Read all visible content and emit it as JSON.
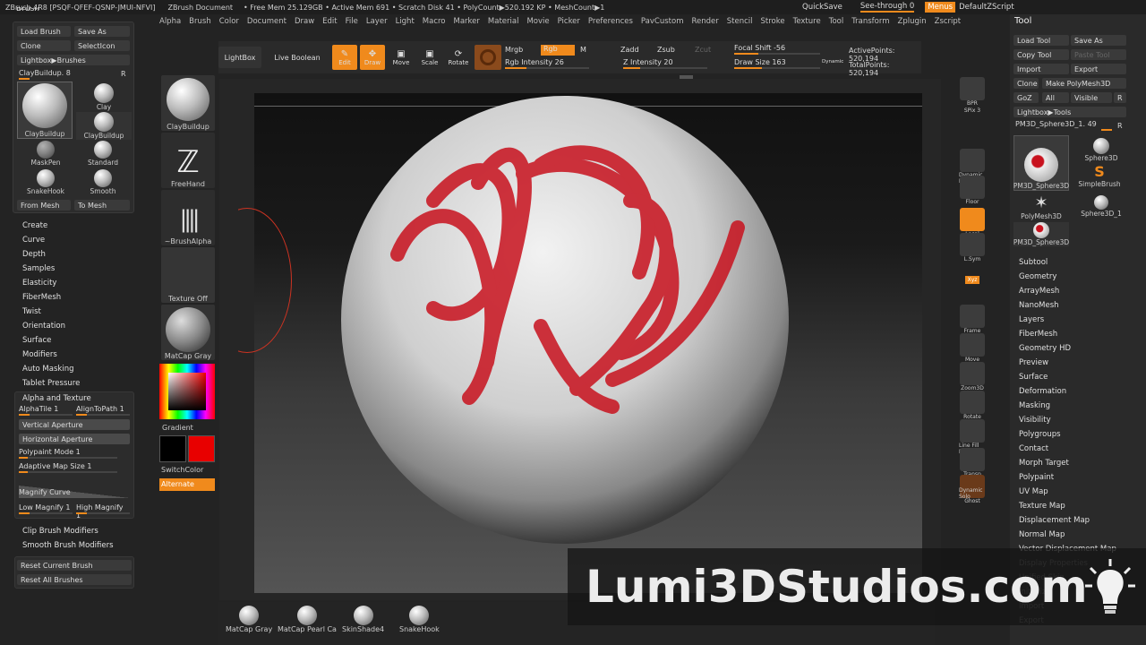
{
  "titlebar": {
    "app": "ZBrush 4R8 [PSQF-QFEF-QSNP-JMUI-NFVI]",
    "doc": "ZBrush Document",
    "freemem": "• Free Mem 25.129GB • Active Mem 691 • Scratch Disk 41 • PolyCount▶520.192 KP • MeshCount▶1"
  },
  "topright": {
    "quicksave": "QuickSave",
    "seethrough": "See-through  0",
    "menus": "Menus",
    "script": "DefaultZScript"
  },
  "menubar": [
    "Alpha",
    "Brush",
    "Color",
    "Document",
    "Draw",
    "Edit",
    "File",
    "Layer",
    "Light",
    "Macro",
    "Marker",
    "Material",
    "Movie",
    "Picker",
    "Preferences",
    "PavCustom",
    "Render",
    "Stencil",
    "Stroke",
    "Texture",
    "Tool",
    "Transform",
    "Zplugin",
    "Zscript"
  ],
  "toolbar": {
    "lightbox": "LightBox",
    "liveboolean": "Live Boolean",
    "edit": "Edit",
    "draw": "Draw",
    "move": "Move",
    "scale": "Scale",
    "rotate": "Rotate",
    "mrgb": "Mrgb",
    "rgb": "Rgb",
    "m": "M",
    "zadd": "Zadd",
    "zsub": "Zsub",
    "zcut": "Zcut",
    "rgb_intensity": "Rgb Intensity 26",
    "z_intensity": "Z Intensity 20",
    "focal_shift": "Focal Shift -56",
    "draw_size": "Draw Size 163",
    "dynamic": "Dynamic",
    "active_points": "ActivePoints: 520,194",
    "total_points": "TotalPoints: 520,194"
  },
  "brushpanel": {
    "header": "Brush",
    "load": "Load Brush",
    "saveas": "Save As",
    "clone": "Clone",
    "selecticon": "SelectIcon",
    "lightbox": "Lightbox▶Brushes",
    "current": "ClayBuildup. 8",
    "r": "R",
    "brushes": [
      "ClayBuildup",
      "Clay",
      "ClayBuildup",
      "MaskPen",
      "Standard",
      "SnakeHook",
      "Smooth"
    ],
    "frommesh": "From Mesh",
    "tomesh": "To Mesh"
  },
  "brushmenu": [
    "Create",
    "Curve",
    "Depth",
    "Samples",
    "Elasticity",
    "FiberMesh",
    "Twist",
    "Orientation",
    "Surface",
    "Modifiers",
    "Auto Masking",
    "Tablet Pressure"
  ],
  "alphatexture": {
    "header": "Alpha and Texture",
    "alphatile": "AlphaTile 1",
    "aligntopath": "AlignToPath 1",
    "vertical": "Vertical Aperture",
    "horizontal": "Horizontal Aperture",
    "polypaint": "Polypaint Mode 1",
    "adaptive": "Adaptive Map Size 1",
    "magnify": "Magnify Curve",
    "lowmag": "Low Magnify 1",
    "highmag": "High Magnify 1"
  },
  "brushfooter": [
    "Clip Brush Modifiers",
    "Smooth Brush Modifiers"
  ],
  "reset": {
    "current": "Reset Current Brush",
    "all": "Reset All Brushes"
  },
  "strip": {
    "claybuildup": "ClayBuildup",
    "freehand": "FreeHand",
    "brushalpha": "~BrushAlpha",
    "texture": "Texture Off",
    "matcap": "MatCap Gray",
    "gradient": "Gradient",
    "switchcolor": "SwitchColor",
    "alternate": "Alternate"
  },
  "rightshelf": [
    "BPR",
    "SPix 3",
    "Dynamic Persp",
    "Floor",
    "Local",
    "L.Sym",
    "Xyz",
    "Frame",
    "Move",
    "Zoom3D",
    "Rotate",
    "Line Fill PolyF",
    "Transp",
    "Ghost",
    "Dynamic Solo"
  ],
  "toolpanel": {
    "title": "Tool",
    "loadtool": "Load Tool",
    "saveas": "Save As",
    "copytool": "Copy Tool",
    "pastetool": "Paste Tool",
    "import": "Import",
    "export": "Export",
    "clone": "Clone",
    "makepoly": "Make PolyMesh3D",
    "goz": "GoZ",
    "all": "All",
    "visible": "Visible",
    "r": "R",
    "lightbox": "Lightbox▶Tools",
    "current": "PM3D_Sphere3D_1. 49",
    "tools": [
      "PM3D_Sphere3D",
      "Sphere3D",
      "SimpleBrush",
      "PolyMesh3D",
      "Sphere3D_1",
      "PM3D_Sphere3D"
    ],
    "menu": [
      "Subtool",
      "Geometry",
      "ArrayMesh",
      "NanoMesh",
      "Layers",
      "FiberMesh",
      "Geometry HD",
      "Preview",
      "Surface",
      "Deformation",
      "Masking",
      "Visibility",
      "Polygroups",
      "Contact",
      "Morph Target",
      "Polypaint",
      "UV Map",
      "Texture Map",
      "Displacement Map",
      "Normal Map",
      "Vector Displacement Map",
      "Display Properties",
      "Unified Skin",
      "Initialize",
      "Import",
      "Export"
    ]
  },
  "materials": [
    "MatCap Gray",
    "MatCap Pearl Ca",
    "SkinShade4",
    "SnakeHook"
  ],
  "watermark": "Lumi3DStudios.com",
  "colors": {
    "accent": "#f08a1c",
    "paint": "#c8121e",
    "primary": "#000000",
    "secondary": "#e80000"
  }
}
